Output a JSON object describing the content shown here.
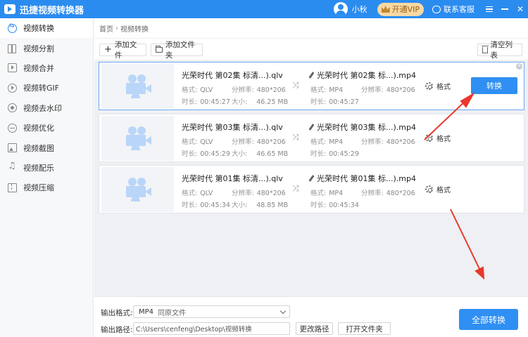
{
  "app": {
    "title": "迅捷视频转换器",
    "username": "小秋",
    "vip_label": "开通VIP",
    "service_label": "联系客服"
  },
  "sidebar": {
    "items": [
      {
        "label": "视频转换",
        "icon": "convert-icon",
        "active": true
      },
      {
        "label": "视频分割",
        "icon": "split-icon"
      },
      {
        "label": "视频合并",
        "icon": "merge-icon"
      },
      {
        "label": "视频转GIF",
        "icon": "gif-icon"
      },
      {
        "label": "视频去水印",
        "icon": "watermark-icon"
      },
      {
        "label": "视频优化",
        "icon": "optimize-icon"
      },
      {
        "label": "视频截图",
        "icon": "screenshot-icon"
      },
      {
        "label": "视频配乐",
        "icon": "music-icon"
      },
      {
        "label": "视频压缩",
        "icon": "compress-icon"
      }
    ]
  },
  "breadcrumb": {
    "home": "首页",
    "separator": "›",
    "current": "视频转换"
  },
  "toolbar": {
    "add_file": "添加文件",
    "add_folder": "添加文件夹",
    "clear_list": "清空列表"
  },
  "labels": {
    "format": "格式:",
    "resolution": "分辨率:",
    "duration": "时长:",
    "size": "大小:",
    "format_setting": "格式",
    "convert": "转换"
  },
  "files": [
    {
      "src_name": "光荣时代 第02集 标清...).qlv",
      "src_format": "QLV",
      "src_resolution": "480*206",
      "src_duration": "00:45:27",
      "src_size": "46.25 MB",
      "dst_name": "光荣时代 第02集 标...).mp4",
      "dst_format": "MP4",
      "dst_resolution": "480*206",
      "dst_duration": "00:45:27",
      "selected": true
    },
    {
      "src_name": "光荣时代 第03集 标清...).qlv",
      "src_format": "QLV",
      "src_resolution": "480*206",
      "src_duration": "00:45:29",
      "src_size": "46.65 MB",
      "dst_name": "光荣时代 第03集 标...).mp4",
      "dst_format": "MP4",
      "dst_resolution": "480*206",
      "dst_duration": "00:45:29"
    },
    {
      "src_name": "光荣时代 第01集 标清...).qlv",
      "src_format": "QLV",
      "src_resolution": "480*206",
      "src_duration": "00:45:34",
      "src_size": "48.85 MB",
      "dst_name": "光荣时代 第01集 标...).mp4",
      "dst_format": "MP4",
      "dst_resolution": "480*206",
      "dst_duration": "00:45:34"
    }
  ],
  "bottom": {
    "format_label": "输出格式:",
    "format_value": "MP4",
    "format_sub": "同原文件",
    "path_label": "输出路径:",
    "path_value": "C:\\Users\\cenfeng\\Desktop\\视频转换",
    "change_path": "更改路径",
    "open_folder": "打开文件夹",
    "convert_all": "全部转换"
  },
  "colors": {
    "accent": "#2f8ff2",
    "titlebar": "#2b8cf0",
    "annotation_arrow": "#e8392c"
  }
}
